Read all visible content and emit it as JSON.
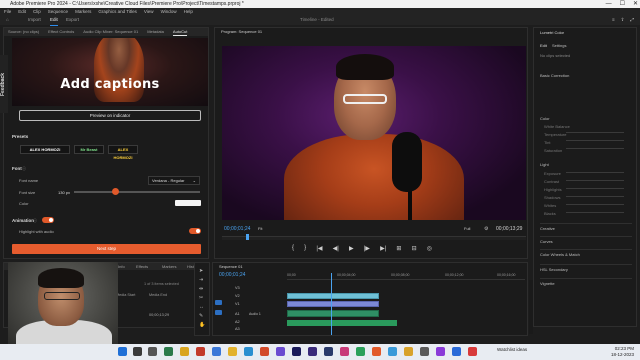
{
  "window": {
    "title": "Adobe Premiere Pro 2024 - C:\\Users\\xshe\\Creative Cloud Files\\Premiere Pro\\Project\\Timestamps.prproj *",
    "min": "—",
    "max": "☐",
    "close": "✕"
  },
  "menu": [
    "File",
    "Edit",
    "Clip",
    "Sequence",
    "Markers",
    "Graphics and Titles",
    "View",
    "Window",
    "Help"
  ],
  "workspaces": {
    "tabs": [
      "Import",
      "Edit",
      "Export"
    ],
    "active": "Edit",
    "center_title": "Timeline - Edited"
  },
  "source_panel": {
    "tabs": [
      "Source: (no clips)",
      "Effect Controls",
      "Audio Clip Mixer: Sequence 01",
      "Metadata",
      "AutoCut"
    ],
    "active_tab": "AutoCut",
    "feedback": "Feedback",
    "hero_text": "Add captions",
    "preview_button": "Preview on indicator",
    "presets_label": "Presets",
    "presets": [
      "ALEX HORMOZI",
      "Mr Beast",
      "ALEX HORMOZI"
    ],
    "font_label": "Font",
    "font_name_label": "Font name",
    "font_name_value": "Verdana - Regular",
    "font_size_label": "Font size",
    "font_size_value": "130 px",
    "color_label": "Color",
    "animation_label": "Animation",
    "highlight_label": "Highlight with audio",
    "next_button": "Next step"
  },
  "program": {
    "tab": "Program: Sequence 01",
    "timecode_left": "00;00;01;24",
    "fit": "Fit",
    "full": "Full",
    "timecode_right": "00;00;13;29",
    "transport": [
      "{",
      "}",
      "|◀",
      "◀|",
      "▶",
      "|▶",
      "▶|",
      "⊞",
      "⊟",
      "◎"
    ]
  },
  "lumetri": {
    "title": "Lumetri Color",
    "tabs": [
      "Edit",
      "Settings"
    ],
    "no_clip": "No clips selected",
    "sections": [
      "Basic Correction",
      "Color",
      "Light",
      "Creative",
      "Curves",
      "Color Wheels & Match",
      "HSL Secondary",
      "Vignette"
    ],
    "color_rows": [
      "White Balance",
      "Temperature",
      "Tint",
      "Saturation"
    ],
    "light_rows": [
      "Exposure",
      "Contrast",
      "Highlights",
      "Shadows",
      "Whites",
      "Blacks"
    ]
  },
  "project": {
    "tabs": [
      "Project: Timest",
      "Libraries",
      "Info",
      "Effects",
      "Markers",
      "History"
    ],
    "col1": "Media Start",
    "col2": "Media End",
    "item_label": "1 of 3 items selected",
    "timecode": "00;00;13;29"
  },
  "timeline": {
    "tab": "Sequence 01",
    "timecode": "00;00;01;24",
    "ruler": [
      "00;00",
      "00;00;04;00",
      "00;00;08;00",
      "00;00;12;00",
      "00;00;16;00"
    ],
    "tracks": [
      "V3",
      "V2",
      "V1",
      "A1",
      "A2",
      "A3"
    ],
    "audio_label": "Audio 1",
    "mix_label": "Mix"
  },
  "taskbar": {
    "weather": "Watchlist ideas",
    "lang": "ENG\nIN",
    "time": "02:23 PM",
    "date": "18-12-2023"
  }
}
